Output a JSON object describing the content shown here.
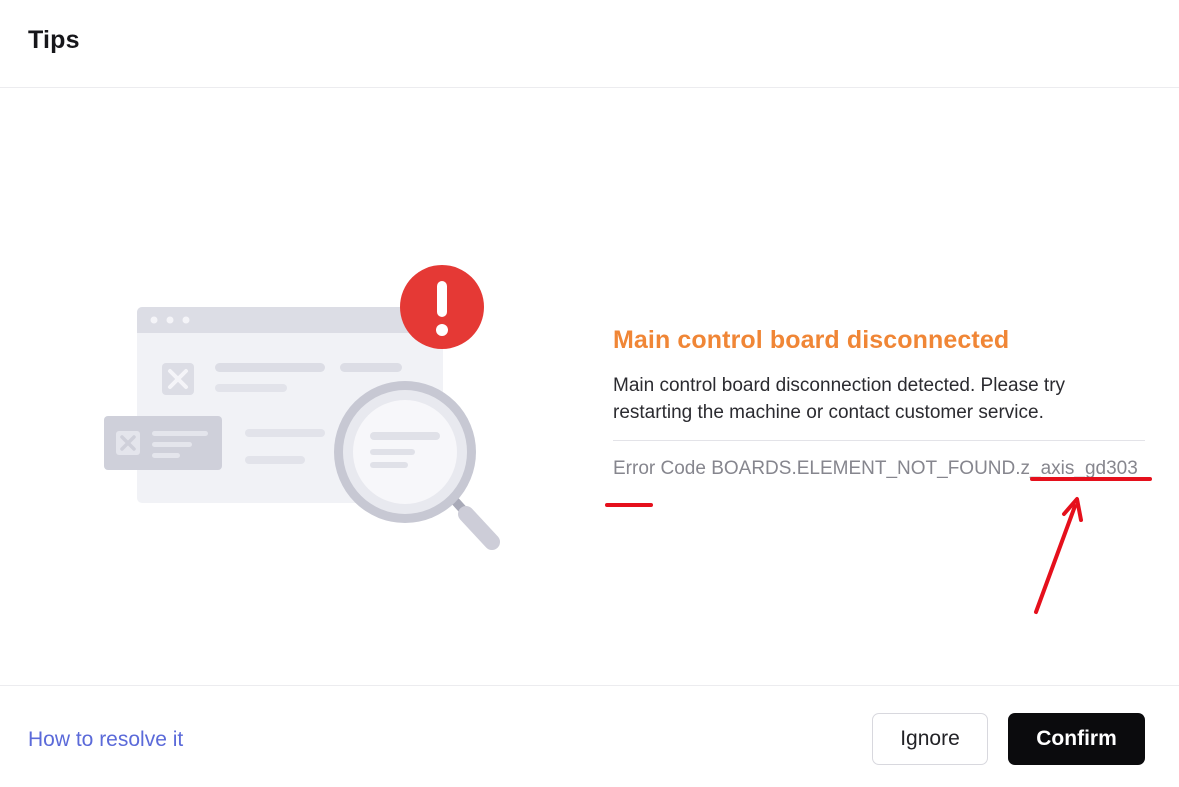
{
  "dialog": {
    "title": "Tips"
  },
  "error": {
    "title": "Main control board disconnected",
    "description": "Main control board disconnection detected. Please try restarting the machine or contact customer service.",
    "code_text": "Error Code BOARDS.ELEMENT_NOT_FOUND.z_axis_gd303"
  },
  "footer": {
    "resolve_link": "How to resolve it",
    "ignore_label": "Ignore",
    "confirm_label": "Confirm"
  },
  "icons": {
    "alert": "exclamation-circle-icon",
    "magnifier": "magnifier-icon",
    "close_x": "close-icon"
  },
  "colors": {
    "error_title": "#f08636",
    "alert_badge": "#e53935",
    "link": "#5b6ad9",
    "confirm_bg": "#0b0b0d",
    "annotation": "#e5101c"
  }
}
